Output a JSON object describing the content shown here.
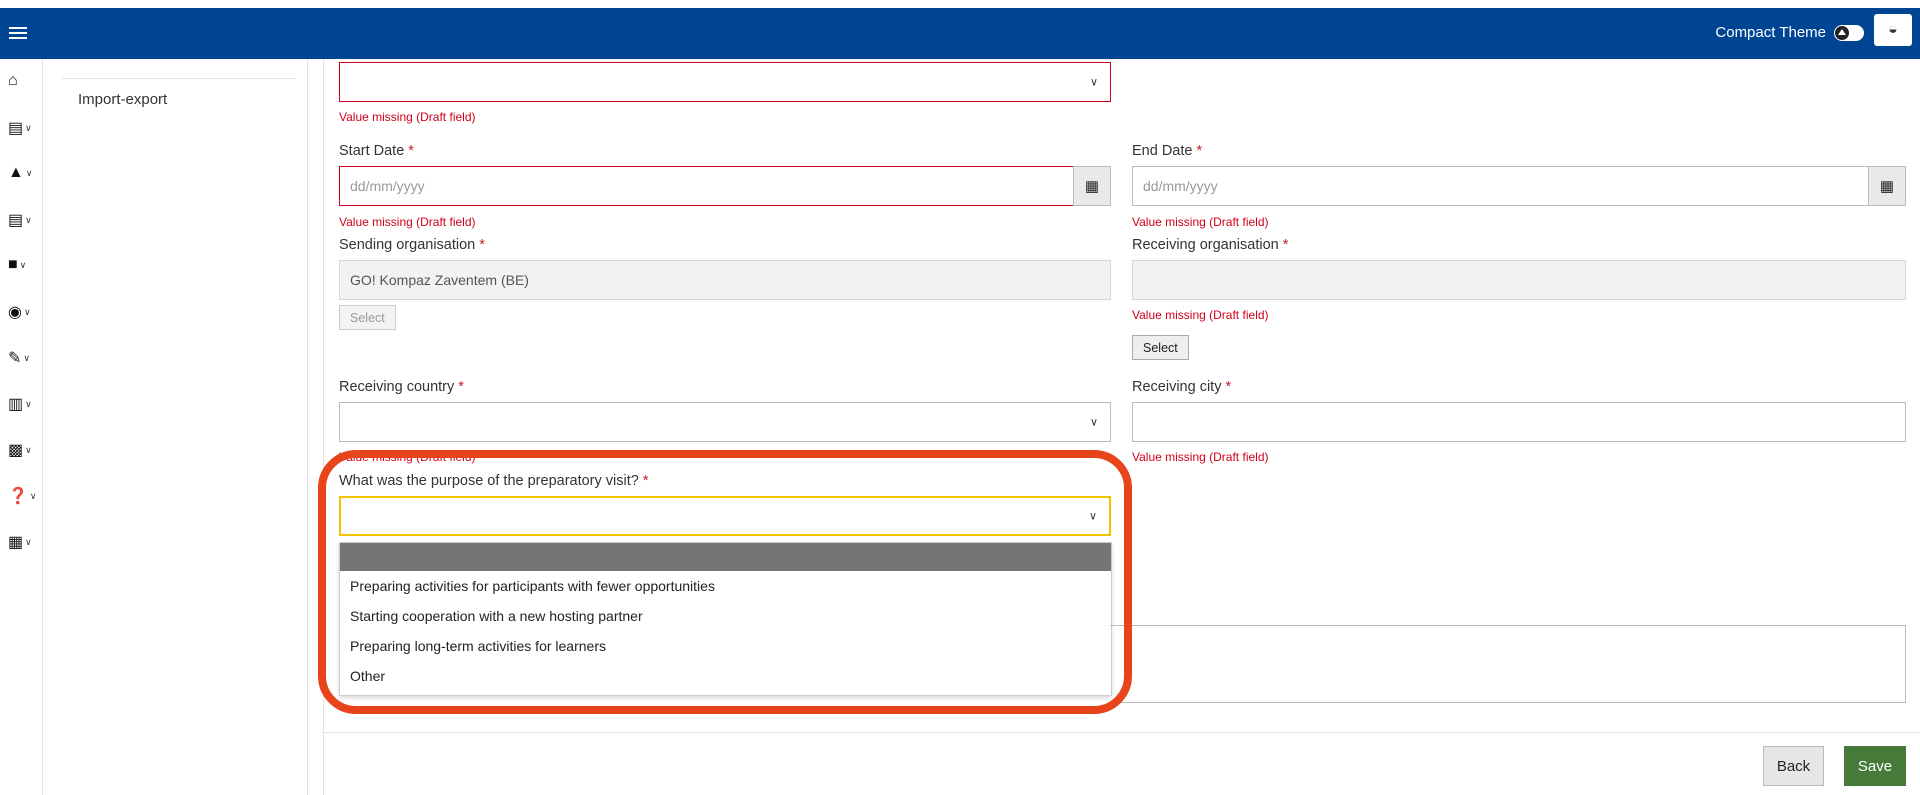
{
  "topbar": {
    "theme_label": "Compact Theme"
  },
  "icons": {
    "menu": "hamburger-icon",
    "paint": "paint-bucket-icon"
  },
  "sidenav": {
    "link": "Import-export"
  },
  "form": {
    "top_error": "Value missing (Draft field)",
    "start_date": {
      "label": "Start Date",
      "placeholder": "dd/mm/yyyy",
      "error": "Value missing (Draft field)"
    },
    "end_date": {
      "label": "End Date",
      "placeholder": "dd/mm/yyyy",
      "error": "Value missing (Draft field)"
    },
    "sending_org": {
      "label": "Sending organisation",
      "value": "GO! Kompaz Zaventem (BE)",
      "button": "Select"
    },
    "receiving_org": {
      "label": "Receiving organisation",
      "error": "Value missing (Draft field)",
      "button": "Select"
    },
    "receiving_country": {
      "label": "Receiving country",
      "error": "Value missing (Draft field)"
    },
    "receiving_city": {
      "label": "Receiving city",
      "error": "Value missing (Draft field)"
    },
    "purpose": {
      "label": "What was the purpose of the preparatory visit?",
      "options": [
        "Preparing activities for participants with fewer opportunities",
        "Starting cooperation with a new hosting partner",
        "Preparing long-term activities for learners",
        "Other"
      ]
    },
    "required_mark": "*"
  },
  "footer": {
    "back_label": "Back",
    "save_label": "Save"
  },
  "colors": {
    "topbar": "#004494",
    "error": "#d0021b",
    "save": "#467a39",
    "highlight": "#e8441c"
  }
}
